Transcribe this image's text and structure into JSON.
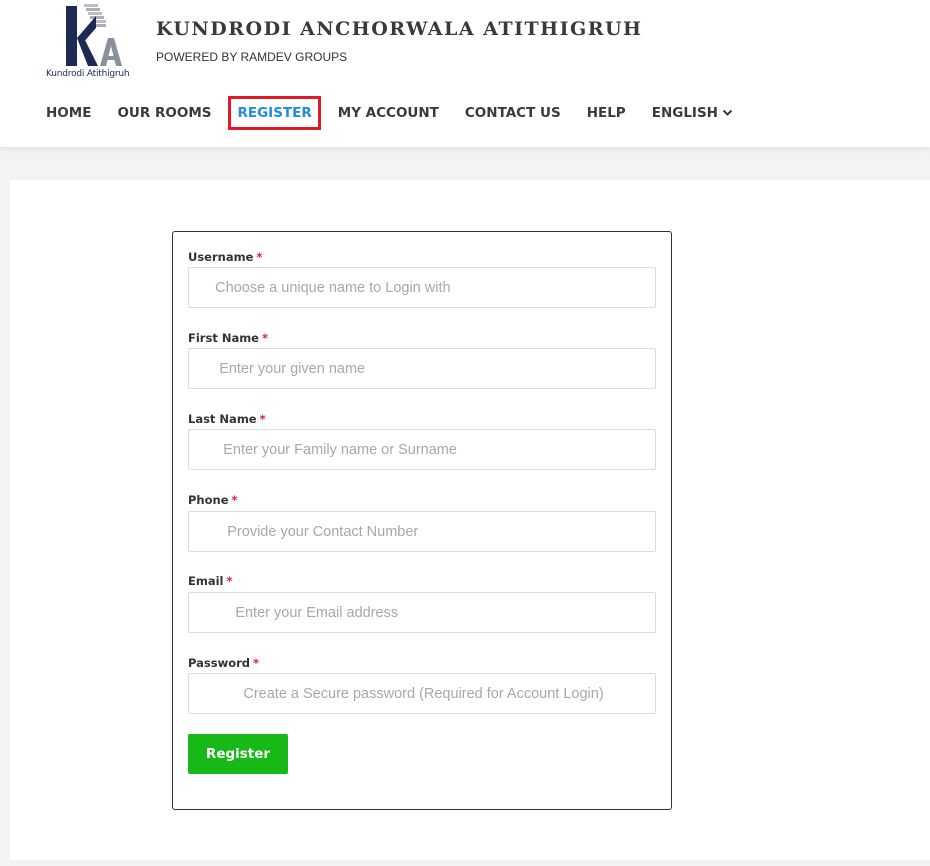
{
  "site": {
    "title": "KUNDRODI ANCHORWALA ATITHIGRUH",
    "tagline": "POWERED BY RAMDEV GROUPS",
    "logo_caption": "Kundrodi Atithigruh",
    "logo_letters": "KA"
  },
  "nav": {
    "items": [
      {
        "label": "HOME"
      },
      {
        "label": "OUR ROOMS"
      },
      {
        "label": "REGISTER"
      },
      {
        "label": "MY ACCOUNT"
      },
      {
        "label": "CONTACT US"
      },
      {
        "label": "HELP"
      },
      {
        "label": "ENGLISH"
      }
    ],
    "active_index": 2,
    "dropdown_icon": "chevron-down-icon"
  },
  "form": {
    "required_marker": "*",
    "fields": [
      {
        "label": "Username",
        "placeholder": "      Choose a unique name to Login with",
        "value": ""
      },
      {
        "label": "First Name",
        "placeholder": "       Enter your given name",
        "value": ""
      },
      {
        "label": "Last Name",
        "placeholder": "        Enter your Family name or Surname",
        "value": ""
      },
      {
        "label": "Phone",
        "placeholder": "         Provide your Contact Number",
        "value": ""
      },
      {
        "label": "Email",
        "placeholder": "           Enter your Email address",
        "value": ""
      },
      {
        "label": "Password",
        "placeholder": "             Create a Secure password (Required for Account Login)",
        "value": ""
      }
    ],
    "submit_label": "Register"
  },
  "colors": {
    "active_nav_text": "#1b8ee0",
    "active_nav_border": "#e01a28",
    "button_bg": "#16b916",
    "required": "#d6232f",
    "logo_navy": "#1d2a55"
  }
}
